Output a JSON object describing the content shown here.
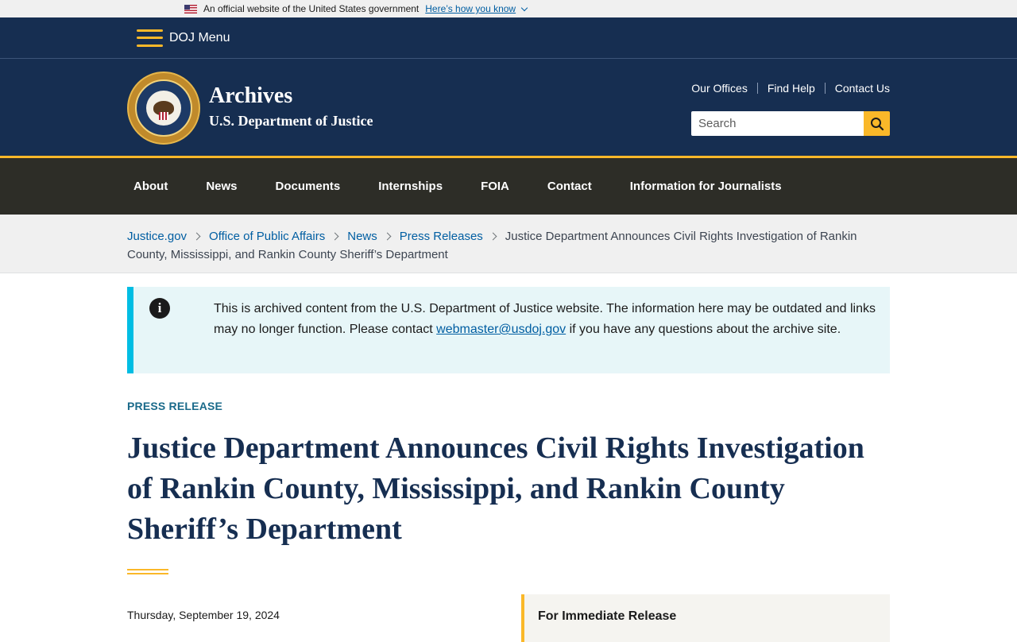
{
  "gov_banner": {
    "text": "An official website of the United States government",
    "link": "Here’s how you know"
  },
  "doj_menu": {
    "label": "DOJ Menu"
  },
  "header": {
    "title": "Archives",
    "subtitle": "U.S. Department of Justice",
    "utility_links": [
      "Our Offices",
      "Find Help",
      "Contact Us"
    ],
    "search": {
      "placeholder": "Search"
    }
  },
  "nav": {
    "items": [
      "About",
      "News",
      "Documents",
      "Internships",
      "FOIA",
      "Contact",
      "Information for Journalists"
    ]
  },
  "breadcrumb": {
    "links": [
      "Justice.gov",
      "Office of Public Affairs",
      "News",
      "Press Releases"
    ],
    "current": "Justice Department Announces Civil Rights Investigation of Rankin County, Mississippi, and Rankin County Sheriff’s Department"
  },
  "alert": {
    "text_before": "This is archived content from the U.S. Department of Justice website. The information here may be outdated and links may no longer function. Please contact ",
    "email": "webmaster@usdoj.gov",
    "text_after": " if you have any questions about the archive site."
  },
  "article": {
    "eyebrow": "PRESS RELEASE",
    "title": "Justice Department Announces Civil Rights Investigation of Rankin County, Mississippi, and Rankin County Sheriff’s Department",
    "date": "Thursday, September 19, 2024",
    "release_label": "For Immediate Release"
  },
  "colors": {
    "navy": "#162e51",
    "gold": "#fab829",
    "nav_bg": "#2d2d27",
    "link": "#005ea2",
    "alert_border": "#00bde3",
    "alert_bg": "#e7f6f8"
  }
}
